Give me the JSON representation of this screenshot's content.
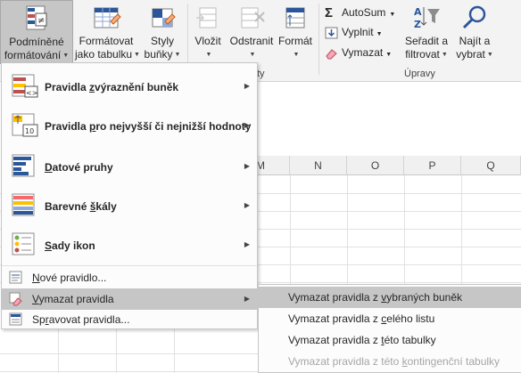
{
  "ribbon": {
    "conditional_formatting": {
      "line1": "Podmíněné",
      "line2": "formátování"
    },
    "format_as_table": {
      "line1": "Formátovat",
      "line2": "jako tabulku"
    },
    "cell_styles": {
      "line1": "Styly",
      "line2": "buňky"
    },
    "insert": {
      "label": "Vložit"
    },
    "delete": {
      "label": "Odstranit"
    },
    "format": {
      "label": "Formát"
    },
    "cells_group_label_fragment": "ty",
    "autosum": {
      "label": "AutoSum"
    },
    "fill": {
      "label": "Vyplnit"
    },
    "clear": {
      "label": "Vymazat"
    },
    "sort_filter": {
      "line1": "Seřadit a",
      "line2": "filtrovat"
    },
    "find_select": {
      "line1": "Najít a",
      "line2": "vybrat"
    },
    "editing_group_label": "Úpravy"
  },
  "columns": [
    "M",
    "N",
    "O",
    "P",
    "Q"
  ],
  "menu": {
    "highlight_rules": {
      "prefix": "Pravidla ",
      "accel": "z",
      "suffix": "výraznění buněk"
    },
    "top_bottom_rules": {
      "prefix": "Pravidla ",
      "accel": "p",
      "suffix": "ro nejvyšší či nejnižší hodnoty"
    },
    "data_bars": {
      "accel": "D",
      "suffix": "atové pruhy"
    },
    "color_scales": {
      "prefix": "Barevné ",
      "accel": "š",
      "suffix": "kály"
    },
    "icon_sets": {
      "accel": "S",
      "suffix": "ady ikon"
    },
    "new_rule": {
      "accel": "N",
      "suffix": "ové pravidlo..."
    },
    "clear_rules": {
      "accel": "V",
      "suffix": "ymazat pravidla"
    },
    "manage_rules": {
      "prefix": "Sp",
      "accel": "r",
      "suffix": "avovat pravidla..."
    }
  },
  "submenu": {
    "from_selected": {
      "prefix": "Vymazat pravidla z ",
      "accel": "v",
      "suffix": "ybraných buněk"
    },
    "from_sheet": {
      "prefix": "Vymazat pravidla z ",
      "accel": "c",
      "suffix": "elého listu"
    },
    "from_table": {
      "prefix": "Vymazat pravidla z ",
      "accel": "t",
      "suffix": "éto tabulky"
    },
    "from_pivot": {
      "prefix": "Vymazat pravidla z této ",
      "accel": "k",
      "suffix": "ontingenční tabulky"
    }
  },
  "colors": {
    "ribbon_bg": "#f3f3f3",
    "highlight": "#c6c6c6",
    "accent_blue": "#2b579a",
    "disabled": "#a6a6a6"
  }
}
